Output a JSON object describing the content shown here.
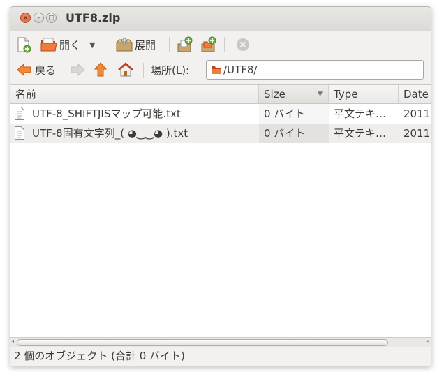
{
  "window": {
    "title": "UTF8.zip"
  },
  "toolbar": {
    "open_label": "開く",
    "extract_label": "展開"
  },
  "location": {
    "back_label": "戻る",
    "place_label": "場所(L):",
    "path": "/UTF8/"
  },
  "table": {
    "columns": [
      "名前",
      "Size",
      "Type",
      "Date"
    ],
    "rows": [
      {
        "name": "UTF-8_SHIFTJISマップ可能.txt",
        "size": "0 バイト",
        "type": "平文テキ…",
        "date": "2011"
      },
      {
        "name": "UTF-8固有文字列_( ◕‿‿◕ ).txt",
        "size": "0 バイト",
        "type": "平文テキ…",
        "date": "2011"
      }
    ]
  },
  "status": {
    "text": "2 個のオブジェクト (合計 0 バイト)"
  },
  "colors": {
    "accent_orange": "#e96a2a",
    "close_button": "#e25c37",
    "alt_row": "#efeeed"
  },
  "icons": {
    "new": "new-archive-icon",
    "open": "open-archive-icon",
    "extract": "extract-icon",
    "add_files": "add-files-icon",
    "add_folder": "add-folder-icon",
    "stop": "stop-icon",
    "back": "back-arrow-icon",
    "forward": "forward-arrow-icon",
    "up": "up-arrow-icon",
    "home": "home-icon",
    "folder": "folder-icon",
    "file": "text-file-icon"
  }
}
